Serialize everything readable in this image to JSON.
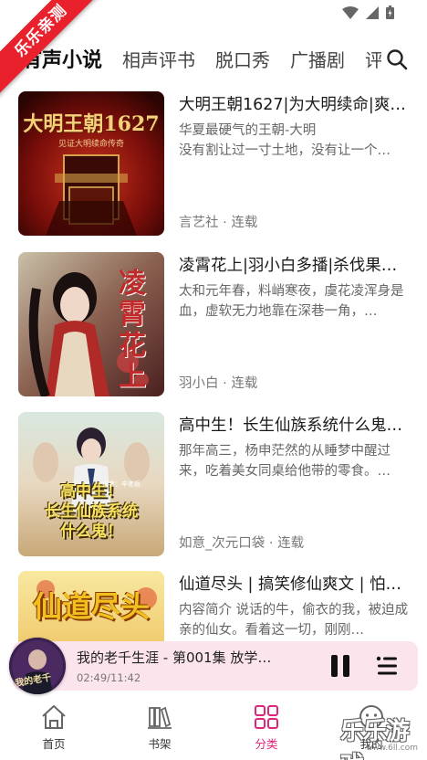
{
  "corner_badge": "乐乐亲测",
  "tabs": [
    {
      "label": "有声小说",
      "active": true
    },
    {
      "label": "相声评书",
      "active": false
    },
    {
      "label": "脱口秀",
      "active": false
    },
    {
      "label": "广播剧",
      "active": false
    },
    {
      "label": "评",
      "active": false
    }
  ],
  "books": [
    {
      "title": "大明王朝1627|为大明续命|爽…",
      "desc": "华夏最硬气的王朝-大明\n没有割让过一寸土地，没有让一个…",
      "meta": "言艺社 · 连载",
      "cover_text": "大明王朝1627",
      "cover_subtext": "见证大明续命传奇"
    },
    {
      "title": "凌霄花上|羽小白多播|杀伐果…",
      "desc": "太和元年春，料峭寒夜，虞花凌浑身是血，虚软无力地靠在深巷一角，…",
      "meta": "羽小白 · 连载",
      "cover_text": "凌霄花上"
    },
    {
      "title": "高中生！长生仙族系统什么鬼…",
      "desc": "那年高三，杨申茫然的从睡梦中醒过来，吃着美女同桌给他带的零食。…",
      "meta": "如意_次元口袋 · 连载",
      "cover_text_1": "高中生！",
      "cover_text_2": "长生仙族系统",
      "cover_text_3": "什么鬼！",
      "cover_author": "作者：辛老板"
    },
    {
      "title": "仙道尽头 | 搞笑修仙爽文 | 怕…",
      "desc": "内容简介 说话的牛，偷衣的我，被迫成亲的仙女。看着这一切，刚刚…",
      "meta": "",
      "cover_text": "仙道尽头"
    }
  ],
  "player": {
    "title": "我的老千生涯 - 第001集 放学…",
    "time": "02:49/11:42",
    "disc_text": "我的老千"
  },
  "nav": [
    {
      "label": "首页",
      "icon": "home-icon",
      "active": false
    },
    {
      "label": "书架",
      "icon": "bookshelf-icon",
      "active": false
    },
    {
      "label": "分类",
      "icon": "category-icon",
      "active": true
    },
    {
      "label": "我的",
      "icon": "profile-icon",
      "active": false
    }
  ],
  "watermark": {
    "text": "乐乐游戏",
    "url": "www.6ll.com"
  },
  "colors": {
    "accent": "#e0267a",
    "badge_red": "#e8212c",
    "player_bg": "#fce4ec"
  }
}
